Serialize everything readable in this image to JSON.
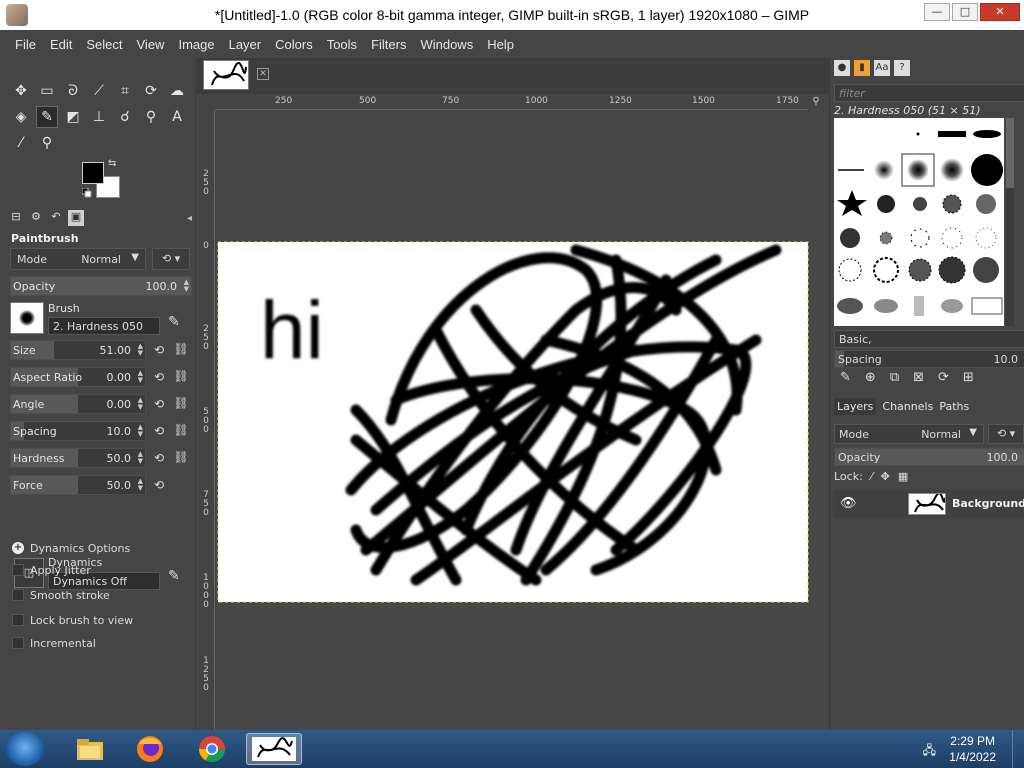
{
  "window": {
    "title": "*[Untitled]-1.0 (RGB color 8-bit gamma integer, GIMP built-in sRGB, 1 layer) 1920x1080 – GIMP",
    "minimize": "—",
    "maximize": "□",
    "close": "✕"
  },
  "menu": [
    "File",
    "Edit",
    "Select",
    "View",
    "Image",
    "Layer",
    "Colors",
    "Tools",
    "Filters",
    "Windows",
    "Help"
  ],
  "tool_options": {
    "title": "Paintbrush",
    "mode_label": "Mode",
    "mode_value": "Normal",
    "opacity": {
      "label": "Opacity",
      "value": "100.0",
      "fraction": 1.0
    },
    "brush_label": "Brush",
    "brush_value": "2. Hardness 050",
    "sliders": [
      {
        "label": "Size",
        "value": "51.00",
        "fraction": 0.32
      },
      {
        "label": "Aspect Ratio",
        "value": "0.00",
        "fraction": 0.5
      },
      {
        "label": "Angle",
        "value": "0.00",
        "fraction": 0.5
      },
      {
        "label": "Spacing",
        "value": "10.0",
        "fraction": 0.1
      },
      {
        "label": "Hardness",
        "value": "50.0",
        "fraction": 0.5
      },
      {
        "label": "Force",
        "value": "50.0",
        "fraction": 0.5
      }
    ],
    "dynamics_label": "Dynamics",
    "dynamics_value": "Dynamics Off",
    "dynamics_options": "Dynamics Options",
    "checks": [
      "Apply Jitter",
      "Smooth stroke",
      "Lock brush to view",
      "Incremental"
    ]
  },
  "ruler": {
    "h_labels": [
      "250",
      "500",
      "750",
      "1000",
      "1250",
      "1500",
      "1750"
    ],
    "v_labels": [
      "250",
      "0",
      "250",
      "500",
      "750",
      "1000",
      "1250"
    ]
  },
  "canvas": {
    "text": "hi"
  },
  "brushes": {
    "filter_placeholder": "filter",
    "selected": "2. Hardness 050 (51 × 51)",
    "tag": "Basic,",
    "spacing": {
      "label": "Spacing",
      "value": "10.0"
    }
  },
  "layers": {
    "tabs": [
      "Layers",
      "Channels",
      "Paths"
    ],
    "mode_label": "Mode",
    "mode_value": "Normal",
    "opacity": {
      "label": "Opacity",
      "value": "100.0"
    },
    "lock_label": "Lock:",
    "items": [
      {
        "name": "Background"
      }
    ]
  },
  "taskbar": {
    "time": "2:29 PM",
    "date": "1/4/2022"
  }
}
